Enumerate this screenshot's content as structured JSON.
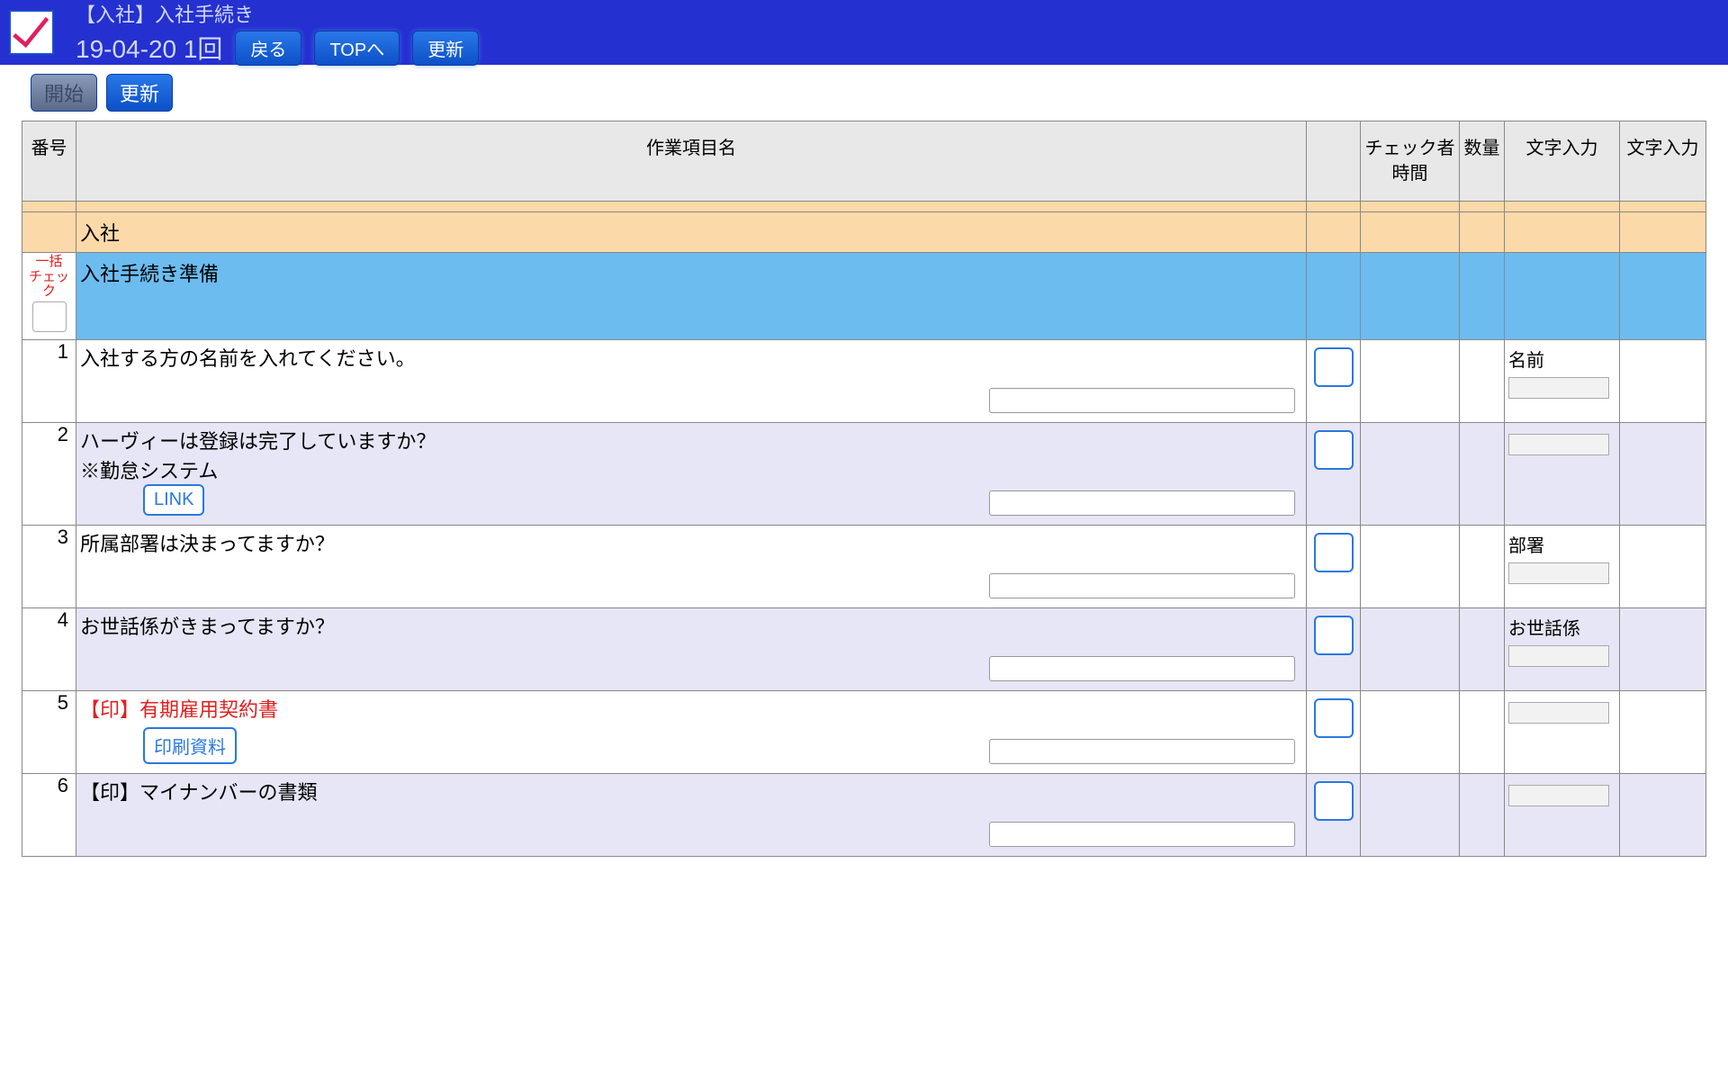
{
  "header": {
    "title": "【入社】入社手続き",
    "subtitle": "19-04-20 1回",
    "btn_back": "戻る",
    "btn_top": "TOPへ",
    "btn_update": "更新"
  },
  "toolbar": {
    "start": "開始",
    "refresh": "更新"
  },
  "columns": {
    "num": "番号",
    "name": "作業項目名",
    "check": "",
    "checker_time": "チェック者\n時間",
    "qty": "数量",
    "text1": "文字入力",
    "text2": "文字入力"
  },
  "section_orange": "入社",
  "section_blue": {
    "batch_label": "一括\nチェック",
    "title": "入社手続き準備"
  },
  "rows": [
    {
      "num": "1",
      "text": "入社する方の名前を入れてください。",
      "note": "",
      "has_link": false,
      "link_label": "",
      "bg": "white",
      "txt1_label": "名前"
    },
    {
      "num": "2",
      "text": "ハーヴィーは登録は完了していますか？",
      "note": "※勤怠システム",
      "has_link": true,
      "link_label": "LINK",
      "bg": "lav",
      "txt1_label": ""
    },
    {
      "num": "3",
      "text": "所属部署は決まってますか？",
      "note": "",
      "has_link": false,
      "link_label": "",
      "bg": "white",
      "txt1_label": "部署"
    },
    {
      "num": "4",
      "text": "お世話係がきまってますか？",
      "note": "",
      "has_link": false,
      "link_label": "",
      "bg": "lav",
      "txt1_label": "お世話係"
    },
    {
      "num": "5",
      "text": "【印】有期雇用契約書",
      "text_red": true,
      "note": "",
      "has_link": true,
      "link_label": "印刷資料",
      "bg": "white",
      "txt1_label": ""
    },
    {
      "num": "6",
      "text": "【印】マイナンバーの書類",
      "note": "",
      "has_link": false,
      "link_label": "",
      "bg": "lav",
      "txt1_label": ""
    }
  ]
}
